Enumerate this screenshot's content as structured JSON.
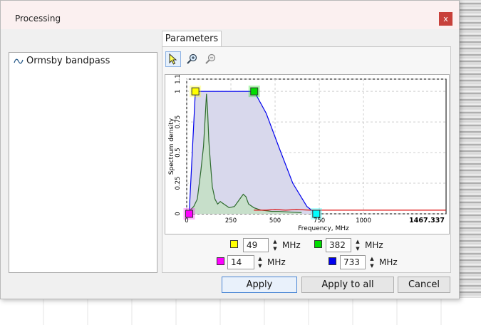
{
  "window": {
    "title": "Processing",
    "close_label": "x"
  },
  "tabs": [
    {
      "label": "Parameters"
    }
  ],
  "filters": [
    {
      "label": "Ormsby bandpass",
      "icon": "wave-icon"
    }
  ],
  "toolbar": {
    "tools": [
      "pointer-icon",
      "zoom-in-icon",
      "zoom-out-icon"
    ]
  },
  "chart_data": {
    "type": "area",
    "xlabel": "Frequency, MHz",
    "ylabel": "Spectrum density",
    "xticks": [
      "0",
      "250",
      "500",
      "750",
      "1000"
    ],
    "yticks": [
      "0",
      "0.25",
      "0.5",
      "0.75",
      "1",
      "1.1"
    ],
    "xlim": [
      0,
      1467.337
    ],
    "ylim": [
      0,
      1.1
    ],
    "x_max_label": "1467.337",
    "grid": true,
    "series": [
      {
        "color": "#0000ee",
        "values": [
          [
            0,
            0
          ],
          [
            14,
            0
          ],
          [
            49,
            1
          ],
          [
            382,
            1
          ],
          [
            450,
            0.82
          ],
          [
            520,
            0.55
          ],
          [
            600,
            0.25
          ],
          [
            680,
            0.06
          ],
          [
            733,
            0
          ]
        ]
      },
      {
        "color": "#2e6b2e",
        "values": [
          [
            0,
            0
          ],
          [
            20,
            0.03
          ],
          [
            40,
            0.06
          ],
          [
            60,
            0.12
          ],
          [
            80,
            0.35
          ],
          [
            95,
            0.55
          ],
          [
            105,
            0.8
          ],
          [
            112,
            0.98
          ],
          [
            118,
            0.85
          ],
          [
            125,
            0.6
          ],
          [
            135,
            0.4
          ],
          [
            145,
            0.22
          ],
          [
            160,
            0.12
          ],
          [
            175,
            0.08
          ],
          [
            190,
            0.1
          ],
          [
            210,
            0.08
          ],
          [
            240,
            0.05
          ],
          [
            270,
            0.06
          ],
          [
            300,
            0.12
          ],
          [
            320,
            0.16
          ],
          [
            335,
            0.14
          ],
          [
            350,
            0.08
          ],
          [
            380,
            0.05
          ],
          [
            420,
            0.03
          ],
          [
            480,
            0.02
          ],
          [
            520,
            0.02
          ],
          [
            580,
            0.015
          ],
          [
            650,
            0.01
          ]
        ]
      },
      {
        "color": "#dd1111",
        "values": [
          [
            380,
            0.03
          ],
          [
            450,
            0.03
          ],
          [
            500,
            0.035
          ],
          [
            560,
            0.03
          ],
          [
            620,
            0.035
          ],
          [
            700,
            0.03
          ],
          [
            800,
            0.03
          ],
          [
            900,
            0.03
          ],
          [
            1000,
            0.03
          ],
          [
            1100,
            0.03
          ],
          [
            1200,
            0.03
          ],
          [
            1300,
            0.03
          ],
          [
            1400,
            0.03
          ],
          [
            1467,
            0.03
          ]
        ]
      }
    ],
    "handles": [
      {
        "color": "#ffff00",
        "x": 49,
        "y": 1
      },
      {
        "color": "#00dd00",
        "x": 382,
        "y": 1
      },
      {
        "color": "#ff00ff",
        "x": 14,
        "y": 0
      },
      {
        "color": "#00ffff",
        "x": 733,
        "y": 0
      }
    ]
  },
  "frequencies": [
    {
      "color": "#ffff00",
      "value": "49",
      "unit": "MHz"
    },
    {
      "color": "#00dd00",
      "value": "382",
      "unit": "MHz"
    },
    {
      "color": "#ff00ff",
      "value": "14",
      "unit": "MHz"
    },
    {
      "color": "#0000ee",
      "value": "733",
      "unit": "MHz"
    }
  ],
  "buttons": {
    "apply": "Apply",
    "apply_all": "Apply to all",
    "cancel": "Cancel"
  }
}
